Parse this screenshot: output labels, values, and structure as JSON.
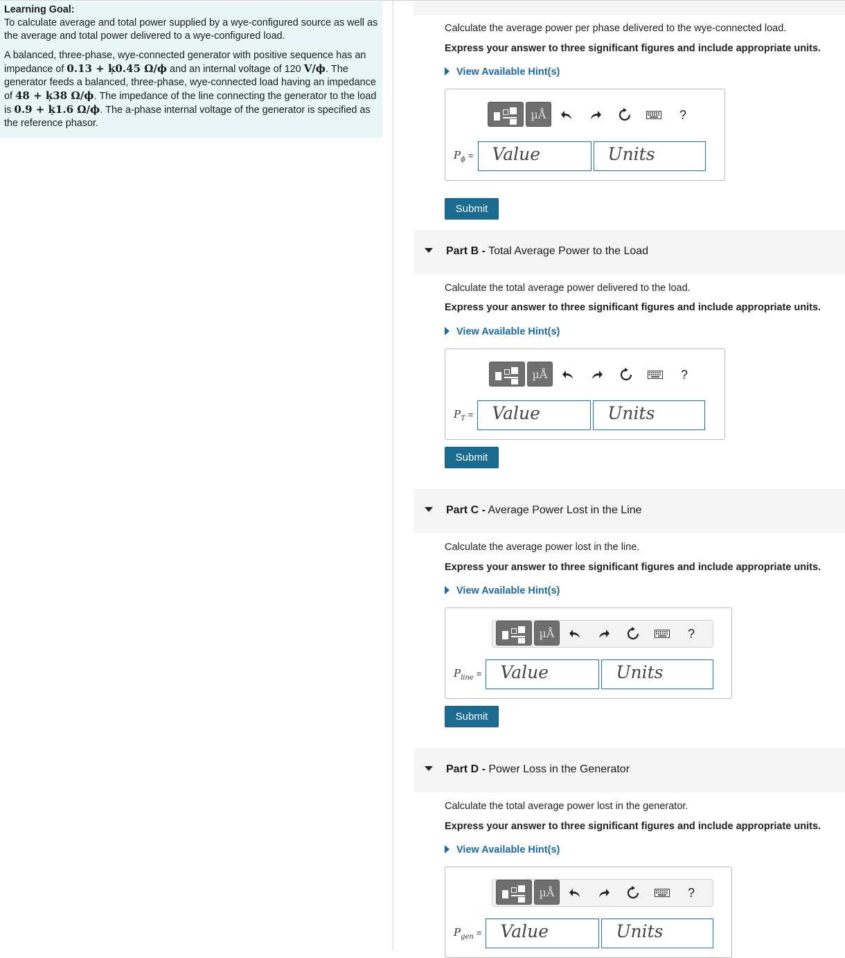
{
  "learning_goal": {
    "title": "Learning Goal:",
    "text": "To calculate average and total power supplied by a wye-configured source as well as the average and total power delivered to a wye-configured load."
  },
  "problem": {
    "p1": "A balanced, three-phase, wye-connected generator with positive sequence has an impedance of ",
    "z_gen": "0.13 + ķ0.45 Ω/ϕ",
    "p2": " and an internal voltage of 120 ",
    "v_unit": "V/ϕ",
    "p3": ". The generator feeds a balanced, three-phase, wye-connected load having an impedance of ",
    "z_load": "48 + ķ38 Ω/ϕ",
    "p4": ". The impedance of the line connecting the generator to the load is ",
    "z_line": "0.9 + ķ1.6 Ω/ϕ",
    "p5": ". The a-phase internal voltage of the generator is specified as the reference phasor."
  },
  "toolbar": {
    "unit_glyph": "µÅ",
    "help": "?",
    "icons": [
      "templates-icon",
      "units-icon",
      "undo-icon",
      "redo-icon",
      "reset-icon",
      "keyboard-icon",
      "help-icon"
    ]
  },
  "common": {
    "instruction": "Express your answer to three significant figures and include appropriate units.",
    "hint_label": "View Available Hint(s)",
    "value_placeholder": "Value",
    "units_placeholder": "Units",
    "submit_label": "Submit",
    "equals": "="
  },
  "parts": [
    {
      "id": "A",
      "question": "Calculate the average power per phase delivered to the wye-connected load.",
      "var": "P",
      "var_sub": "ϕ"
    },
    {
      "id": "B",
      "label": "Part B -",
      "title": "Total Average Power to the Load",
      "question": "Calculate the total average power delivered to the load.",
      "var": "P",
      "var_sub": "T"
    },
    {
      "id": "C",
      "label": "Part C -",
      "title": "Average Power Lost in the Line",
      "question": "Calculate the average power lost in the line.",
      "var": "P",
      "var_sub": "line"
    },
    {
      "id": "D",
      "label": "Part D -",
      "title": "Power Loss in the Generator",
      "question": "Calculate the total average power lost in the generator.",
      "var": "P",
      "var_sub": "gen"
    }
  ]
}
